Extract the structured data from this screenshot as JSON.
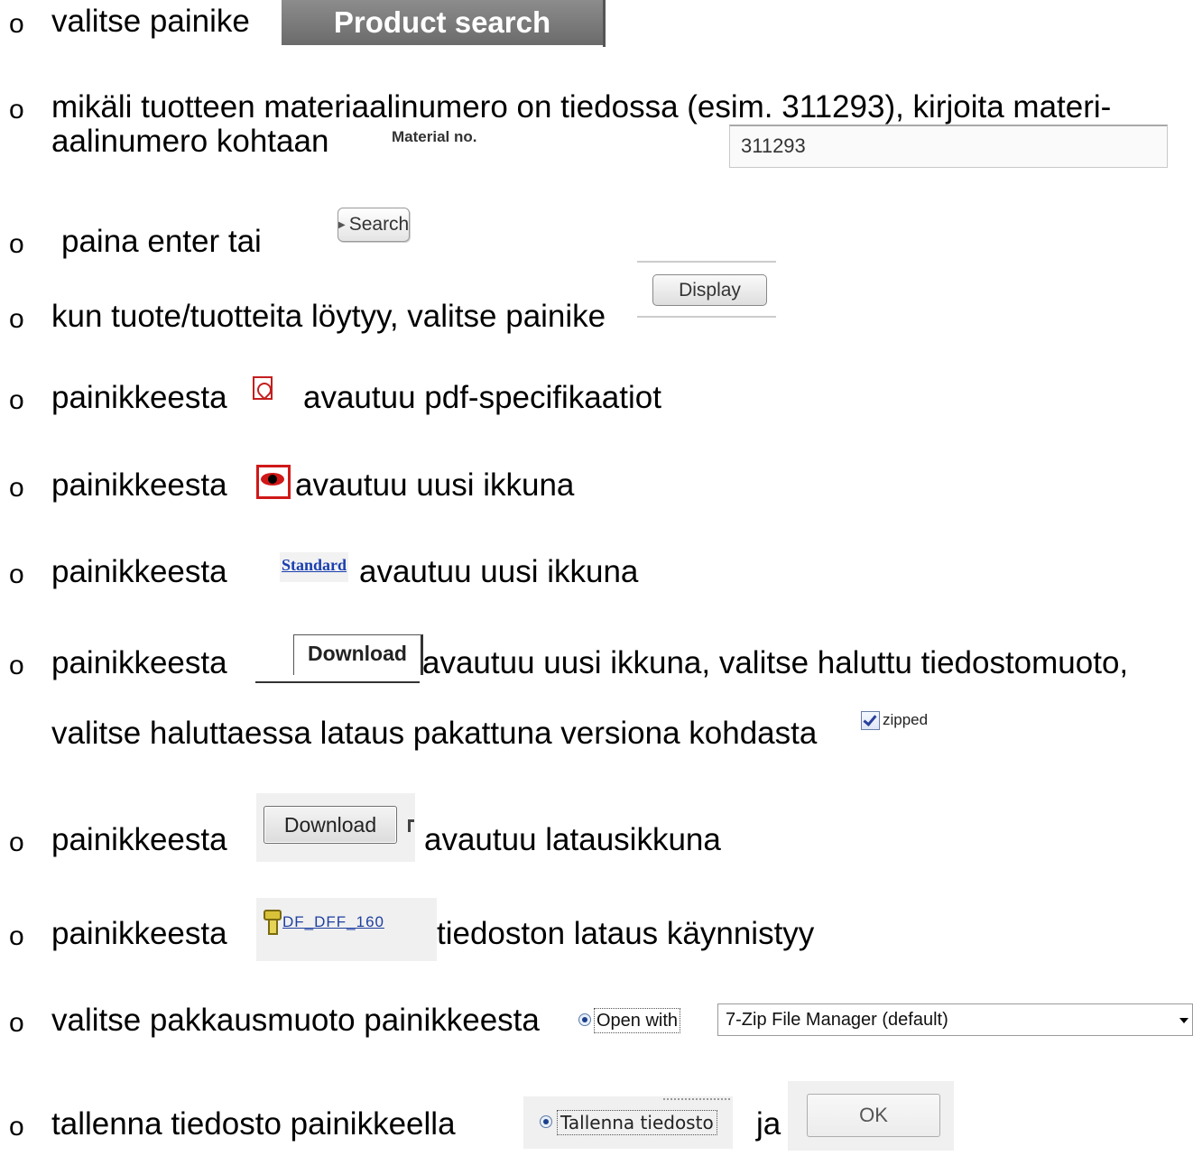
{
  "bullet": "o",
  "steps": {
    "s1": {
      "text": "valitse painike",
      "button": "Product search"
    },
    "s2": {
      "line1": "mikäli tuotteen materiaalinumero on tiedossa (esim. 311293), kirjoita materi-",
      "line2": "aalinumero kohtaan",
      "field_label": "Material no.",
      "field_value": "311293"
    },
    "s3": {
      "text": "paina enter tai",
      "button": "Search"
    },
    "s4": {
      "text": "kun tuote/tuotteita löytyy, valitse painike",
      "button": "Display"
    },
    "s5": {
      "before": "painikkeesta",
      "after": "avautuu pdf-specifikaatiot",
      "icon": "pdf-icon"
    },
    "s6": {
      "before": "painikkeesta",
      "after": "avautuu uusi ikkuna",
      "icon": "eye-icon"
    },
    "s7": {
      "before": "painikkeesta",
      "link": "Standard",
      "after": "avautuu uusi ikkuna"
    },
    "s8": {
      "before": "painikkeesta",
      "button": "Download",
      "after": "avautuu uusi ikkuna, valitse haluttu tiedostomuoto,",
      "line2": "valitse haluttaessa lataus pakattuna versiona kohdasta",
      "checkbox_label": "zipped",
      "checkbox_checked": true
    },
    "s9": {
      "before": "painikkeesta",
      "button": "Download",
      "after": "avautuu latausikkuna"
    },
    "s10": {
      "before": "painikkeesta",
      "link": "DF_DFF_160",
      "after": "tiedoston lataus käynnistyy",
      "icon": "screw-icon"
    },
    "s11": {
      "text": "valitse pakkausmuoto painikkeesta",
      "radio_label": "Open with",
      "select_value": "7-Zip File Manager (default)"
    },
    "s12": {
      "text": "tallenna tiedosto painikkeella",
      "radio_label": "Tallenna tiedosto",
      "between": "ja",
      "button": "OK"
    }
  }
}
